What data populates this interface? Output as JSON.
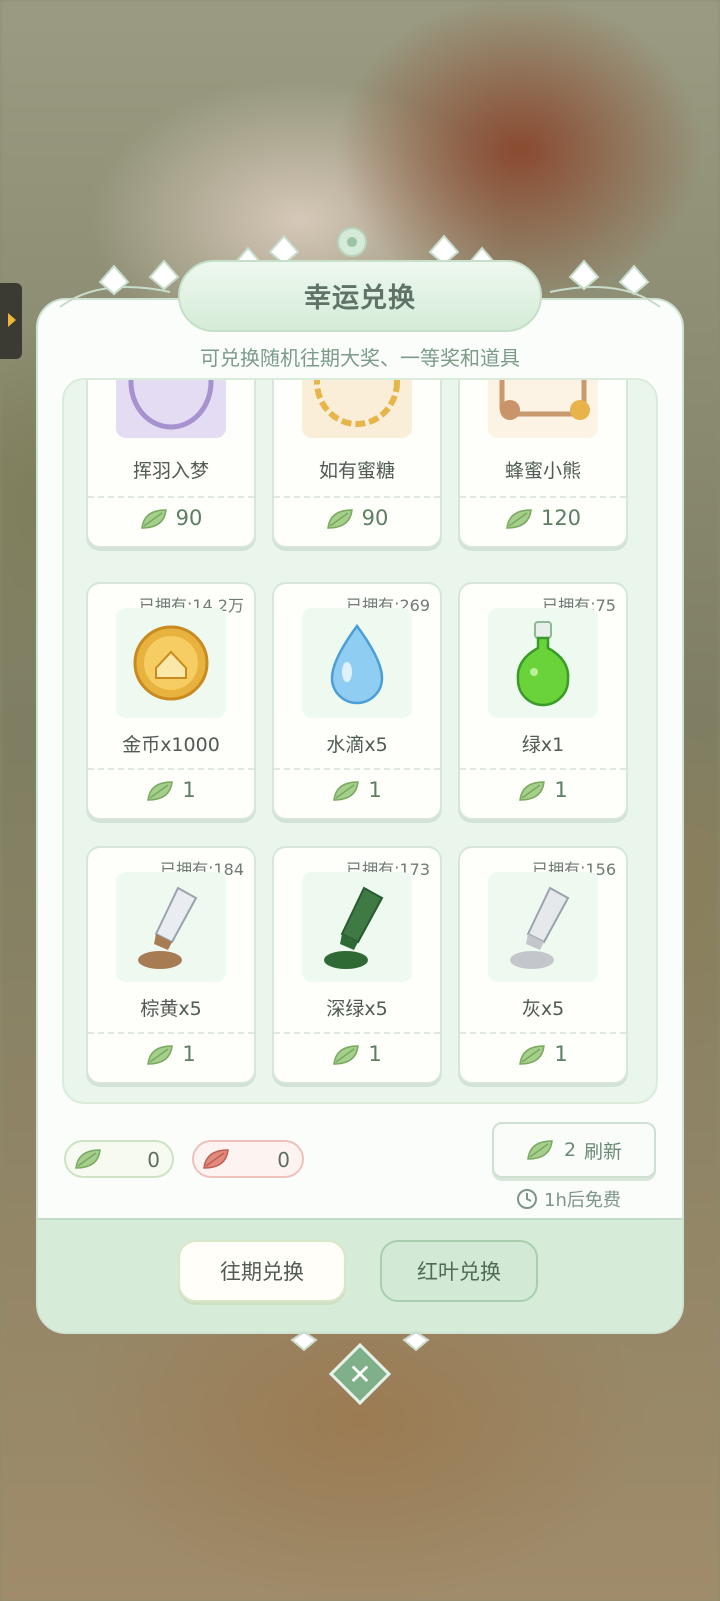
{
  "dialog": {
    "title": "幸运兑换",
    "subtitle": "可兑换随机往期大奖、一等奖和道具"
  },
  "items": [
    {
      "name": "挥羽入梦",
      "owned": "",
      "price": "90",
      "icon": "purple-frame-icon"
    },
    {
      "name": "如有蜜糖",
      "owned": "",
      "price": "90",
      "icon": "gold-chain-frame-icon"
    },
    {
      "name": "蜂蜜小熊",
      "owned": "",
      "price": "120",
      "icon": "honey-bear-frame-icon"
    },
    {
      "name": "金币x1000",
      "owned": "已拥有:14.2万",
      "price": "1",
      "icon": "gold-coin-icon"
    },
    {
      "name": "水滴x5",
      "owned": "已拥有:269",
      "price": "1",
      "icon": "water-drop-icon"
    },
    {
      "name": "绿x1",
      "owned": "已拥有:75",
      "price": "1",
      "icon": "green-potion-icon"
    },
    {
      "name": "棕黄x5",
      "owned": "已拥有:184",
      "price": "1",
      "icon": "brown-paint-tube-icon"
    },
    {
      "name": "深绿x5",
      "owned": "已拥有:173",
      "price": "1",
      "icon": "dark-green-paint-tube-icon"
    },
    {
      "name": "灰x5",
      "owned": "已拥有:156",
      "price": "1",
      "icon": "gray-paint-tube-icon"
    }
  ],
  "currency": {
    "green_leaf": "0",
    "red_leaf": "0"
  },
  "refresh": {
    "cost": "2",
    "label": "刷新",
    "free_timer": "1h后免费"
  },
  "tabs": {
    "past": "往期兑换",
    "red_leaf": "红叶兑换"
  },
  "colors": {
    "accent_green": "#7fb08a",
    "panel_bg": "#fbfdfb",
    "footer_bg": "#d6ecd9"
  }
}
